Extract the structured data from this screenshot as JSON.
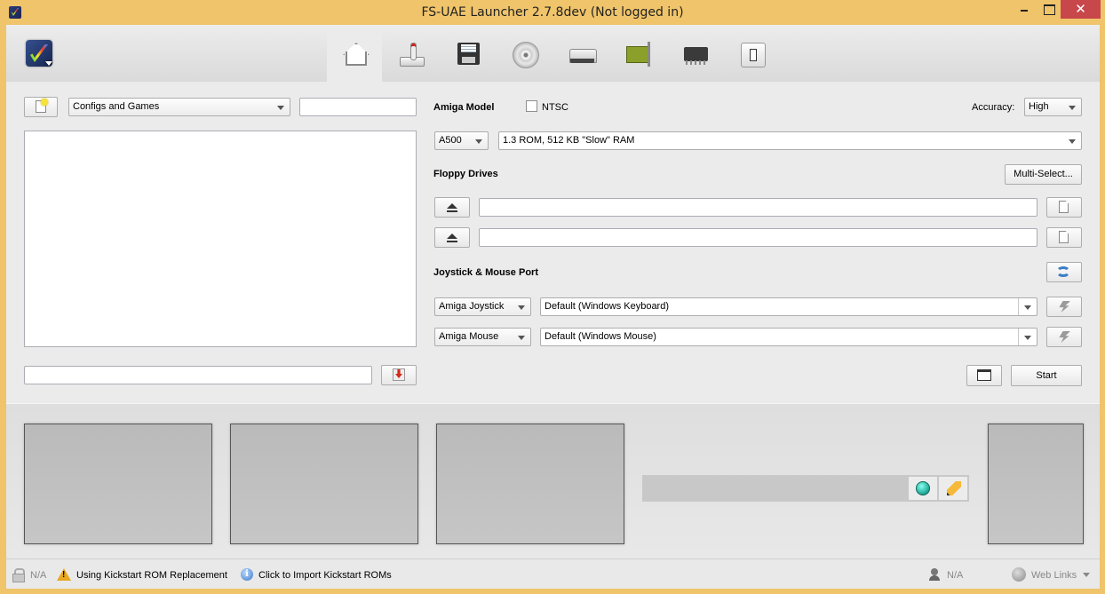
{
  "titlebar": {
    "title": "FS-UAE Launcher 2.7.8dev (Not logged in)",
    "close_glyph": "✕"
  },
  "toolbar": {
    "tabs": [
      {
        "name": "main",
        "icon": "home-icon",
        "active": true
      },
      {
        "name": "input",
        "icon": "joystick-icon"
      },
      {
        "name": "floppies",
        "icon": "floppy-icon"
      },
      {
        "name": "cdroms",
        "icon": "cd-icon"
      },
      {
        "name": "hard-drives",
        "icon": "hard-drive-icon"
      },
      {
        "name": "expansions",
        "icon": "expansion-card-icon"
      },
      {
        "name": "hardware",
        "icon": "chip-icon"
      },
      {
        "name": "additional",
        "icon": "switch-icon"
      }
    ]
  },
  "left": {
    "config_filter": "Configs and Games",
    "search_value": "",
    "config_name_value": ""
  },
  "amiga_model": {
    "heading": "Amiga Model",
    "ntsc_label": "NTSC",
    "ntsc_checked": false,
    "accuracy_label": "Accuracy:",
    "accuracy_value": "High",
    "model_value": "A500",
    "sub_model_value": "1.3 ROM, 512 KB \"Slow\" RAM"
  },
  "floppy": {
    "heading": "Floppy Drives",
    "multi_select_label": "Multi-Select...",
    "drives": [
      {
        "value": ""
      },
      {
        "value": ""
      }
    ]
  },
  "ports": {
    "heading": "Joystick & Mouse Port",
    "rows": [
      {
        "type": "Amiga Joystick",
        "device": "Default (Windows Keyboard)"
      },
      {
        "type": "Amiga Mouse",
        "device": "Default (Windows Mouse)"
      }
    ]
  },
  "actions": {
    "start_label": "Start"
  },
  "status": {
    "lock_text": "N/A",
    "warning_text": "Using Kickstart ROM Replacement",
    "info_text": "Click to Import Kickstart ROMs",
    "info_glyph": "i",
    "user_text": "N/A",
    "web_links_text": "Web Links"
  }
}
